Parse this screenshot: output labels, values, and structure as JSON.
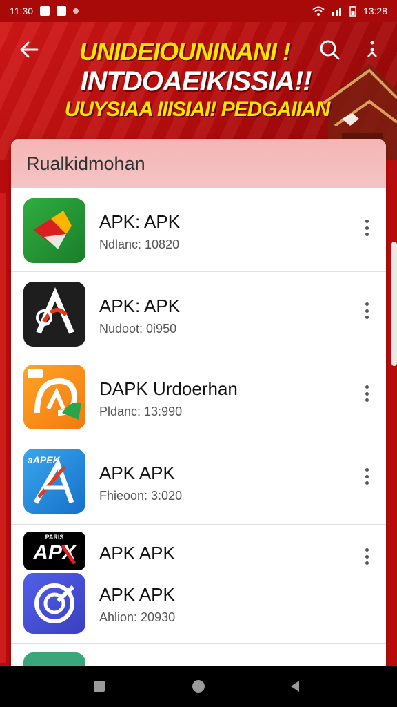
{
  "status_bar": {
    "time": "11:30",
    "right_time": "13:28"
  },
  "header": {
    "line1": "UNIDEIOUNINANI !",
    "line2": "INTDOAEIKISSIA!!",
    "line3": "UUYSIAA IIISIAI! PEDGAIIAN"
  },
  "card": {
    "title": "Rualkidmohan"
  },
  "apps": [
    {
      "title": "APK: APK",
      "subtitle": "Ndlanc: 10820"
    },
    {
      "title": "APK: APK",
      "subtitle": "Nudoot: 0i950"
    },
    {
      "title": "DAPK Urdoerhan",
      "subtitle": "Pldanc: 13:990"
    },
    {
      "title": "APK APK",
      "subtitle": "Fhieoon: 3:020"
    },
    {
      "title": "APK APK",
      "subtitle": ""
    },
    {
      "title": "APK APK",
      "subtitle": "Ahlion: 20930"
    }
  ],
  "icons": {
    "icon4_text": "aAPEK",
    "icon5_text": "APX",
    "icon5_small": "PARIS"
  },
  "colors": {
    "brand_red": "#b80c0c",
    "headline_yellow": "#ffe600",
    "card_header": "#f6b5b5"
  }
}
